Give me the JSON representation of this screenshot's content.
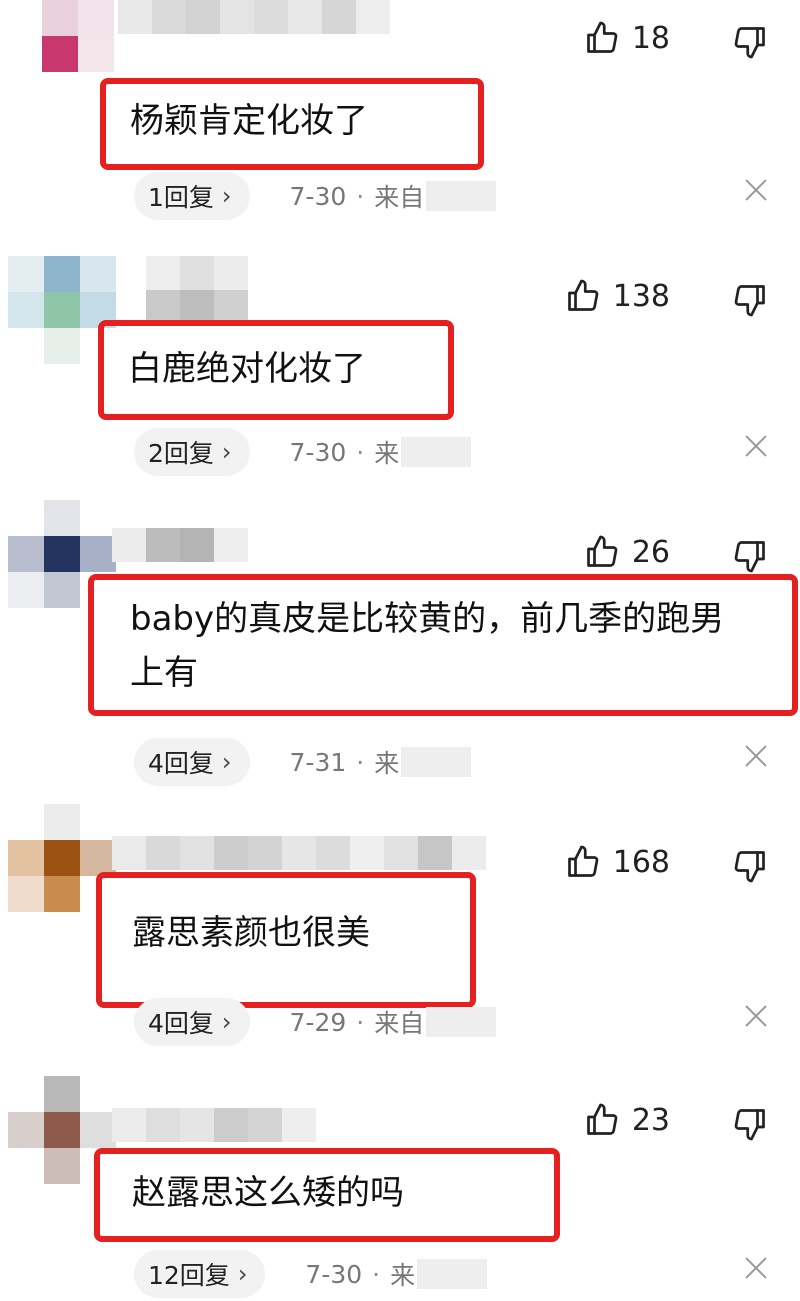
{
  "comments": [
    {
      "likes": "18",
      "text": "杨颖肯定化妆了",
      "replies": "1回复",
      "date": "7-30",
      "dot": "·",
      "source": "来自"
    },
    {
      "likes": "138",
      "text": "白鹿绝对化妆了",
      "replies": "2回复",
      "date": "7-30",
      "dot": "·",
      "source": "来"
    },
    {
      "likes": "26",
      "text": "baby的真皮是比较黄的，前几季的跑男上有",
      "replies": "4回复",
      "date": "7-31",
      "dot": "·",
      "source": "来"
    },
    {
      "likes": "168",
      "text": "露思素颜也很美",
      "replies": "4回复",
      "date": "7-29",
      "dot": "·",
      "source": "来自"
    },
    {
      "likes": "23",
      "text": "赵露思这么矮的吗",
      "replies": "12回复",
      "date": "7-30",
      "dot": "·",
      "source": "来"
    }
  ],
  "chevron": "›",
  "icons": {
    "like": "thumbs-up-icon",
    "dislike": "thumbs-down-icon",
    "close": "close-icon"
  },
  "colors": {
    "highlight_border": "#e42020",
    "reply_pill_bg": "#f2f2f2"
  }
}
